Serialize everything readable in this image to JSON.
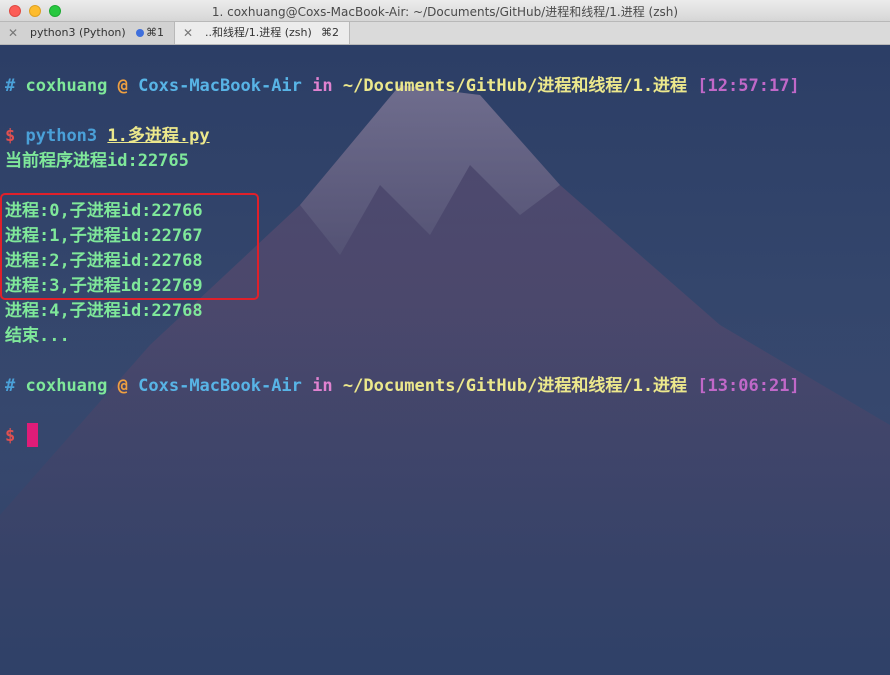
{
  "window": {
    "title": "1. coxhuang@Coxs-MacBook-Air: ~/Documents/GitHub/进程和线程/1.进程 (zsh)"
  },
  "tabs": [
    {
      "close": "✕",
      "label": "python3 (Python)",
      "shortcut": "⌘1",
      "active": false
    },
    {
      "close": "✕",
      "label": "..和线程/1.进程 (zsh)",
      "shortcut": "⌘2",
      "active": true
    }
  ],
  "terminal": {
    "prompt1": {
      "hash": "#",
      "user": "coxhuang",
      "at": "@",
      "host": "Coxs-MacBook-Air",
      "in": "in",
      "path": "~/Documents/GitHub/进程和线程/1.进程",
      "time": "[12:57:17]"
    },
    "command": {
      "dollar": "$",
      "program": "python3",
      "arg": "1.多进程.py"
    },
    "output": [
      "当前程序进程id:22765",
      "",
      "进程:0,子进程id:22766",
      "进程:1,子进程id:22767",
      "进程:2,子进程id:22768",
      "进程:3,子进程id:22769",
      "进程:4,子进程id:22768",
      "结束..."
    ],
    "prompt2": {
      "hash": "#",
      "user": "coxhuang",
      "at": "@",
      "host": "Coxs-MacBook-Air",
      "in": "in",
      "path": "~/Documents/GitHub/进程和线程/1.进程",
      "time": "[13:06:21]"
    },
    "prompt3": {
      "dollar": "$"
    }
  },
  "colors": {
    "cursor": "#e01c78",
    "highlight": "#e0202a",
    "output_text": "#7fe89a"
  }
}
